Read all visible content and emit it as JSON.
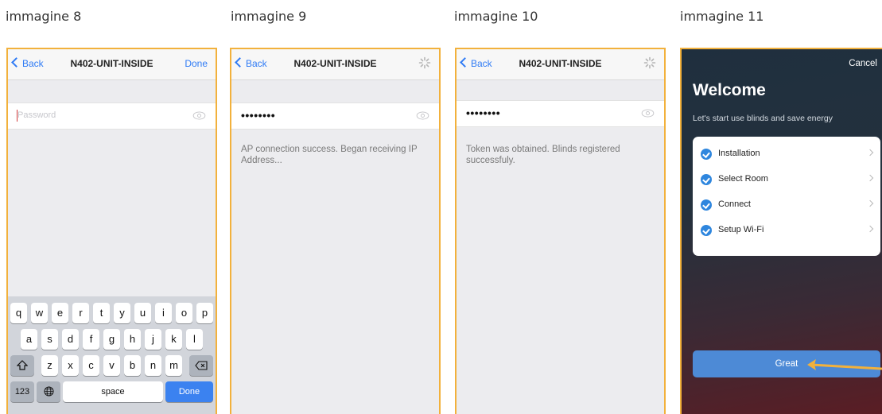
{
  "captions": [
    "immagine 8",
    "immagine 9",
    "immagine 10",
    "immagine 11"
  ],
  "screen8": {
    "back": "Back",
    "title": "N402-UNIT-INSIDE",
    "done": "Done",
    "password_placeholder": "Password",
    "keyboard": {
      "row1": [
        "q",
        "w",
        "e",
        "r",
        "t",
        "y",
        "u",
        "i",
        "o",
        "p"
      ],
      "row2": [
        "a",
        "s",
        "d",
        "f",
        "g",
        "h",
        "j",
        "k",
        "l"
      ],
      "row3": [
        "z",
        "x",
        "c",
        "v",
        "b",
        "n",
        "m"
      ],
      "numbers_key": "123",
      "space_key": "space",
      "done_key": "Done"
    }
  },
  "screen9": {
    "back": "Back",
    "title": "N402-UNIT-INSIDE",
    "password_value": "••••••••",
    "message": "AP connection success. Began receiving IP Address..."
  },
  "screen10": {
    "back": "Back",
    "title": "N402-UNIT-INSIDE",
    "password_value": "••••••••",
    "message": "Token was obtained. Blinds registered successfuly."
  },
  "screen11": {
    "cancel": "Cancel",
    "title": "Welcome",
    "subtitle": "Let's start use blinds and save energy",
    "steps": [
      "Installation",
      "Select Room",
      "Connect",
      "Setup Wi-Fi"
    ],
    "great": "Great"
  },
  "colors": {
    "highlight_border": "#f2b13c",
    "ios_blue": "#2f7bf5",
    "button_blue": "#4d8ad6"
  }
}
